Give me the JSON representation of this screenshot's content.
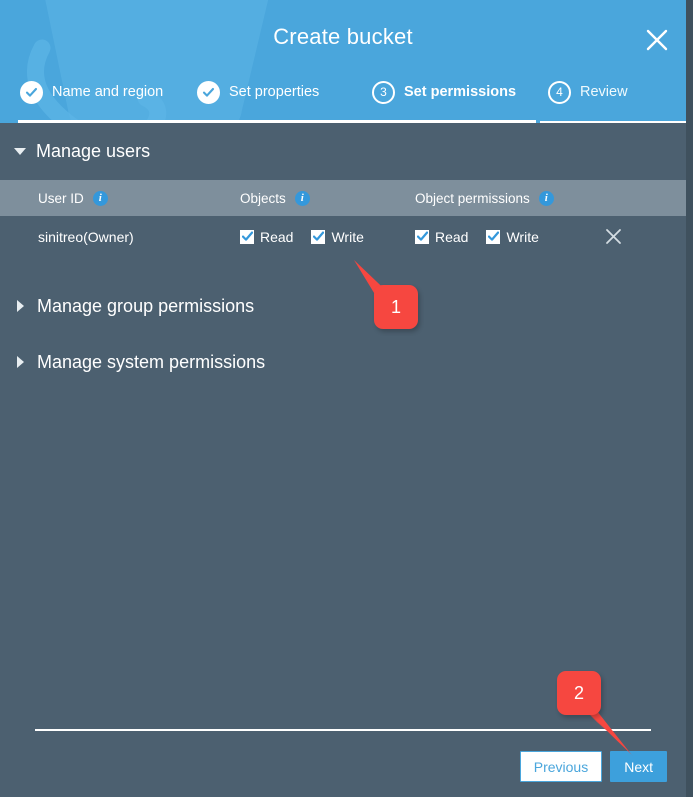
{
  "colors": {
    "header_blue": "#4aa6dc",
    "body_slate": "#4c6070",
    "table_header_slate": "#7e8f9c",
    "accent_blue": "#3498db",
    "callout_red": "#f64740",
    "white": "#ffffff"
  },
  "header": {
    "title": "Create bucket",
    "close_icon": "close-icon",
    "steps": [
      {
        "index": "1",
        "label": "Name and region",
        "state": "completed",
        "icon": "check-circle-icon"
      },
      {
        "index": "2",
        "label": "Set properties",
        "state": "completed",
        "icon": "check-circle-icon"
      },
      {
        "index": "3",
        "label": "Set permissions",
        "state": "active",
        "icon": "number-circle-icon"
      },
      {
        "index": "4",
        "label": "Review",
        "state": "upcoming",
        "icon": "number-circle-icon"
      }
    ]
  },
  "sections": {
    "manage_users": {
      "title": "Manage users",
      "expanded": true,
      "toggle_icon": "caret-down-icon",
      "table": {
        "columns": [
          {
            "key": "user_id",
            "label": "User ID",
            "info_icon": "info-icon"
          },
          {
            "key": "objects",
            "label": "Objects",
            "info_icon": "info-icon"
          },
          {
            "key": "object_permissions",
            "label": "Object permissions",
            "info_icon": "info-icon"
          }
        ],
        "rows": [
          {
            "user_id": "sinitreo(Owner)",
            "objects": [
              {
                "label": "Read",
                "checked": true
              },
              {
                "label": "Write",
                "checked": true
              }
            ],
            "object_permissions": [
              {
                "label": "Read",
                "checked": true
              },
              {
                "label": "Write",
                "checked": true
              }
            ],
            "remove_icon": "close-icon"
          }
        ]
      }
    },
    "manage_group_permissions": {
      "title": "Manage group permissions",
      "expanded": false,
      "toggle_icon": "caret-right-icon"
    },
    "manage_system_permissions": {
      "title": "Manage system permissions",
      "expanded": false,
      "toggle_icon": "caret-right-icon"
    }
  },
  "footer": {
    "previous_label": "Previous",
    "next_label": "Next"
  },
  "callouts": [
    {
      "number": "1",
      "points_to": "write-checkbox-objects"
    },
    {
      "number": "2",
      "points_to": "next-button"
    }
  ]
}
